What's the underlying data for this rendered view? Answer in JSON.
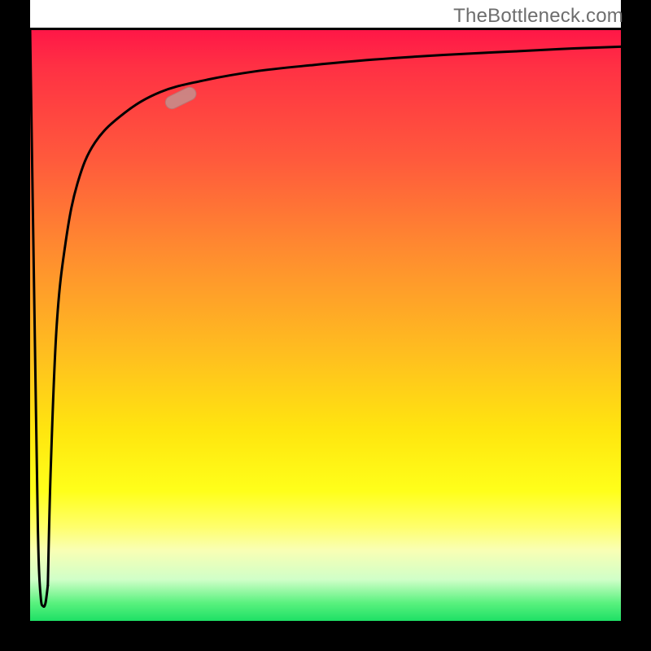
{
  "watermark": "TheBottleneck.com",
  "colors": {
    "curve": "#000000",
    "marker_fill": "#c98a88",
    "marker_stroke": "#b77876",
    "frame": "#000000",
    "gradient_top": "#ff1747",
    "gradient_bottom": "#1ee065"
  },
  "marker": {
    "x_norm": 0.255,
    "y_norm": 0.885,
    "angle_deg": 26
  },
  "chart_data": {
    "type": "line",
    "title": "",
    "xlabel": "",
    "ylabel": "",
    "xlim": [
      0,
      1
    ],
    "ylim": [
      0,
      1
    ],
    "grid": false,
    "legend": false,
    "series": [
      {
        "name": "curve-1",
        "x": [
          0.0,
          0.01,
          0.014,
          0.018,
          0.022,
          0.026,
          0.03
        ],
        "y": [
          1.0,
          0.35,
          0.12,
          0.04,
          0.025,
          0.03,
          0.06
        ]
      },
      {
        "name": "curve-2",
        "x": [
          0.03,
          0.035,
          0.045,
          0.06,
          0.08,
          0.11,
          0.16,
          0.22,
          0.29,
          0.38,
          0.48,
          0.58,
          0.7,
          0.82,
          0.92,
          1.0
        ],
        "y": [
          0.06,
          0.26,
          0.5,
          0.64,
          0.74,
          0.81,
          0.86,
          0.895,
          0.914,
          0.93,
          0.941,
          0.95,
          0.958,
          0.964,
          0.969,
          0.972
        ]
      }
    ],
    "annotations": [
      {
        "type": "marker",
        "x": 0.255,
        "y": 0.895
      }
    ]
  }
}
